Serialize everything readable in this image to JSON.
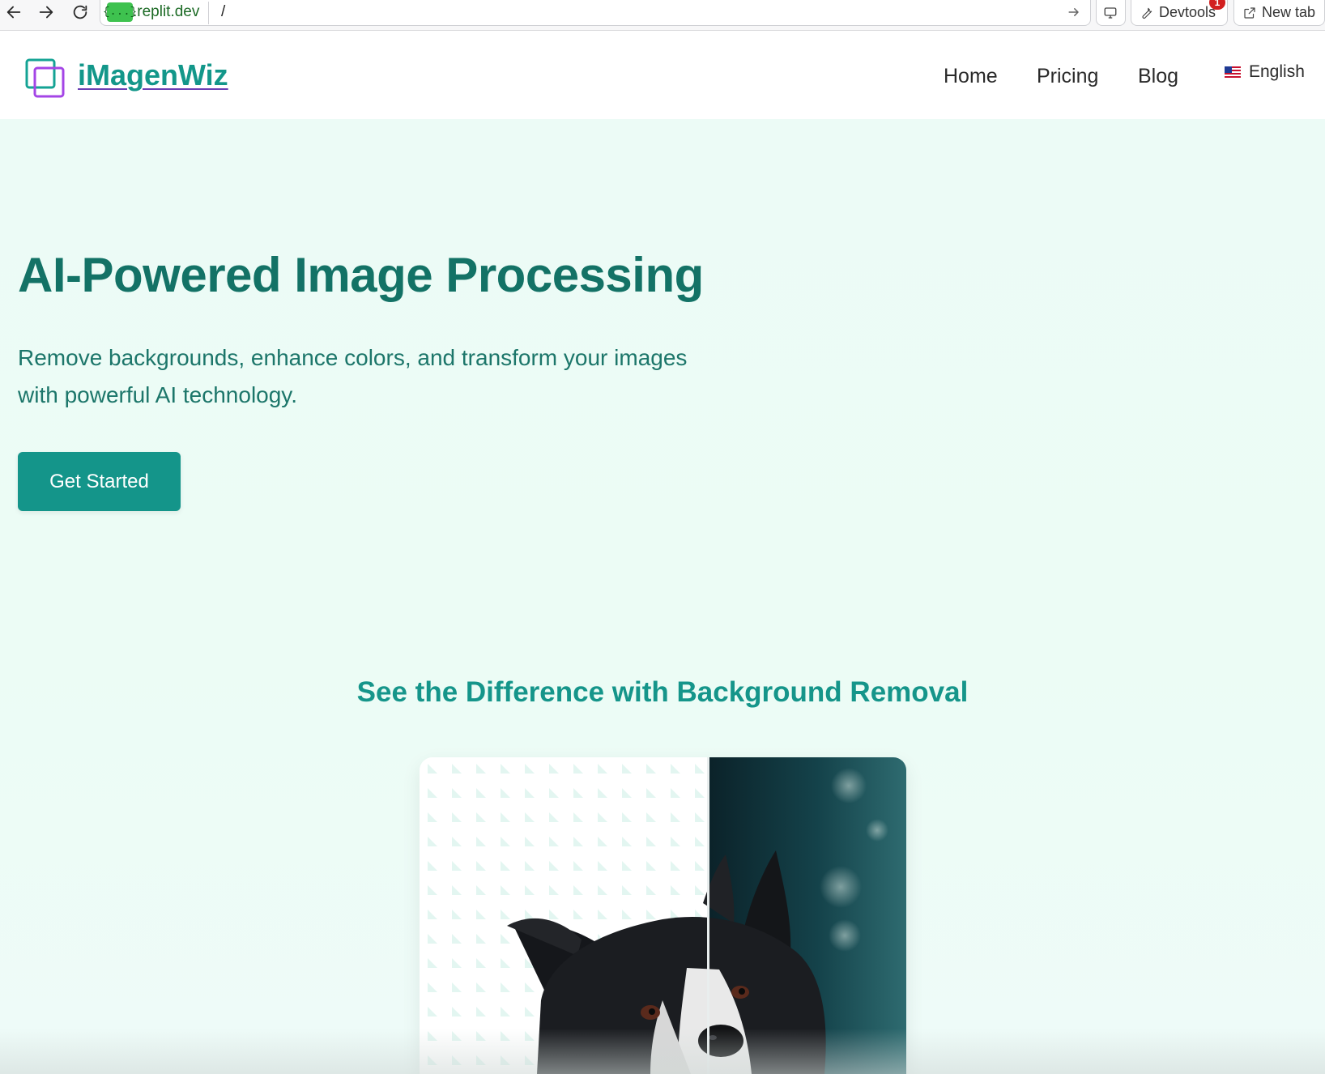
{
  "browser": {
    "url_badge": "{...}",
    "url_host": ".replit.dev",
    "url_path": "/",
    "devtools_label": "Devtools",
    "devtools_count": "1",
    "new_tab_label": "New tab"
  },
  "header": {
    "brand": "iMagenWiz",
    "nav": [
      "Home",
      "Pricing",
      "Blog"
    ],
    "language": "English",
    "language_flag": "us-flag-icon"
  },
  "hero": {
    "title": "AI-Powered Image Processing",
    "subtitle_line1": "Remove backgrounds, enhance colors, and transform your images",
    "subtitle_line2": "with powerful AI technology.",
    "cta": "Get Started"
  },
  "compare": {
    "title": "See the Difference with Background Removal"
  },
  "colors": {
    "brand": "#13978a",
    "title": "#137266",
    "hero_bg": "#ecfbf6",
    "cta_bg": "#14958a"
  }
}
